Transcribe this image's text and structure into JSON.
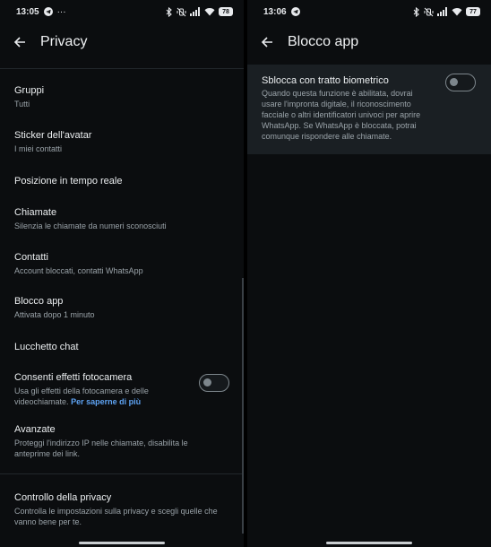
{
  "left": {
    "status": {
      "time": "13:05",
      "extra": "···",
      "battery": "78"
    },
    "title": "Privacy",
    "items": [
      {
        "title": "Gruppi",
        "subtitle": "Tutti"
      },
      {
        "title": "Sticker dell'avatar",
        "subtitle": "I miei contatti"
      },
      {
        "title": "Posizione in tempo reale",
        "subtitle": ""
      },
      {
        "title": "Chiamate",
        "subtitle": "Silenzia le chiamate da numeri sconosciuti"
      },
      {
        "title": "Contatti",
        "subtitle": "Account bloccati, contatti WhatsApp"
      },
      {
        "title": "Blocco app",
        "subtitle": "Attivata dopo 1 minuto"
      },
      {
        "title": "Lucchetto chat",
        "subtitle": ""
      },
      {
        "title": "Consenti effetti fotocamera",
        "subtitle": "Usa gli effetti della fotocamera e delle videochiamate.",
        "link": "Per saperne di più",
        "toggle_on": false
      },
      {
        "title": "Avanzate",
        "subtitle": "Proteggi l'indirizzo IP nelle chiamate, disabilita le anteprime dei link."
      },
      {
        "title": "Controllo della privacy",
        "subtitle": "Controlla le impostazioni sulla privacy e scegli quelle che vanno bene per te."
      }
    ]
  },
  "right": {
    "status": {
      "time": "13:06",
      "battery": "77"
    },
    "title": "Blocco app",
    "setting": {
      "title": "Sblocca con tratto biometrico",
      "description": "Quando questa funzione è abilitata, dovrai usare l'impronta digitale, il riconoscimento facciale o altri identificatori univoci per aprire WhatsApp. Se WhatsApp è bloccata, potrai comunque rispondere alle chiamate.",
      "toggle_on": false
    }
  },
  "icons": [
    "telegram-icon",
    "bluetooth-icon",
    "muted-vibrate-icon",
    "signal-icon",
    "wifi-icon",
    "battery-icon",
    "back-arrow-icon"
  ],
  "colors": {
    "background": "#0b0d0f",
    "card": "#1a1f23",
    "link": "#5ea3f3",
    "subtitle": "#9aa3a9"
  }
}
